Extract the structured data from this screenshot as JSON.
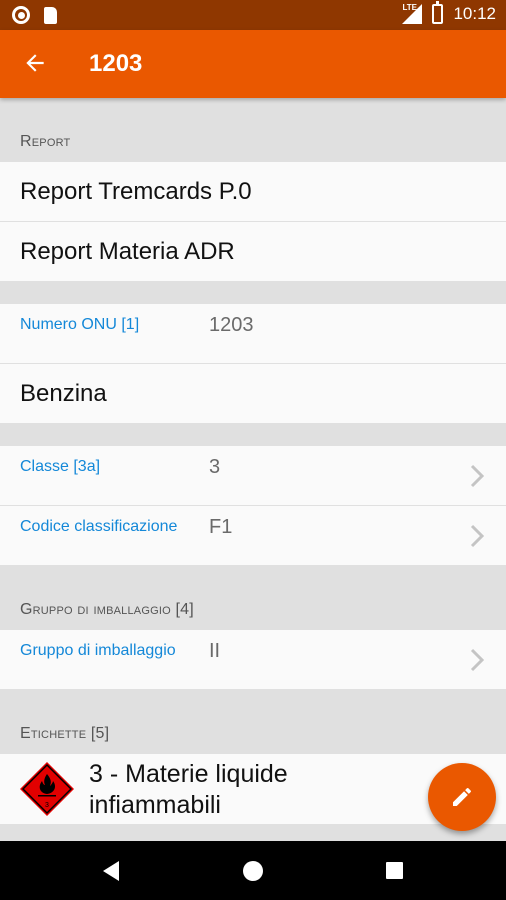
{
  "status_bar": {
    "time": "10:12",
    "network": "LTE"
  },
  "app_bar": {
    "title": "1203",
    "back_icon": "arrow-back-icon"
  },
  "sections": {
    "report": {
      "header": "Report",
      "items": [
        "Report Tremcards P.0",
        "Report Materia ADR"
      ]
    },
    "onu": {
      "key": "Numero ONU [1]",
      "value": "1203"
    },
    "name": "Benzina",
    "classification": [
      {
        "key": "Classe [3a]",
        "value": "3"
      },
      {
        "key": "Codice classificazione",
        "value": "F1"
      }
    ],
    "packing": {
      "header": "Gruppo di imballaggio [4]",
      "key": "Gruppo di imballaggio",
      "value": "II"
    },
    "labels": {
      "header": "Etichette [5]",
      "item": "3 - Materie liquide infiammabili",
      "icon": "flammable-liquid-diamond-icon",
      "icon_number": "3"
    }
  },
  "fab": {
    "icon": "edit-pencil-icon"
  },
  "colors": {
    "accent": "#ea5800",
    "status_bar": "#8f3700",
    "link": "#1488d8"
  }
}
